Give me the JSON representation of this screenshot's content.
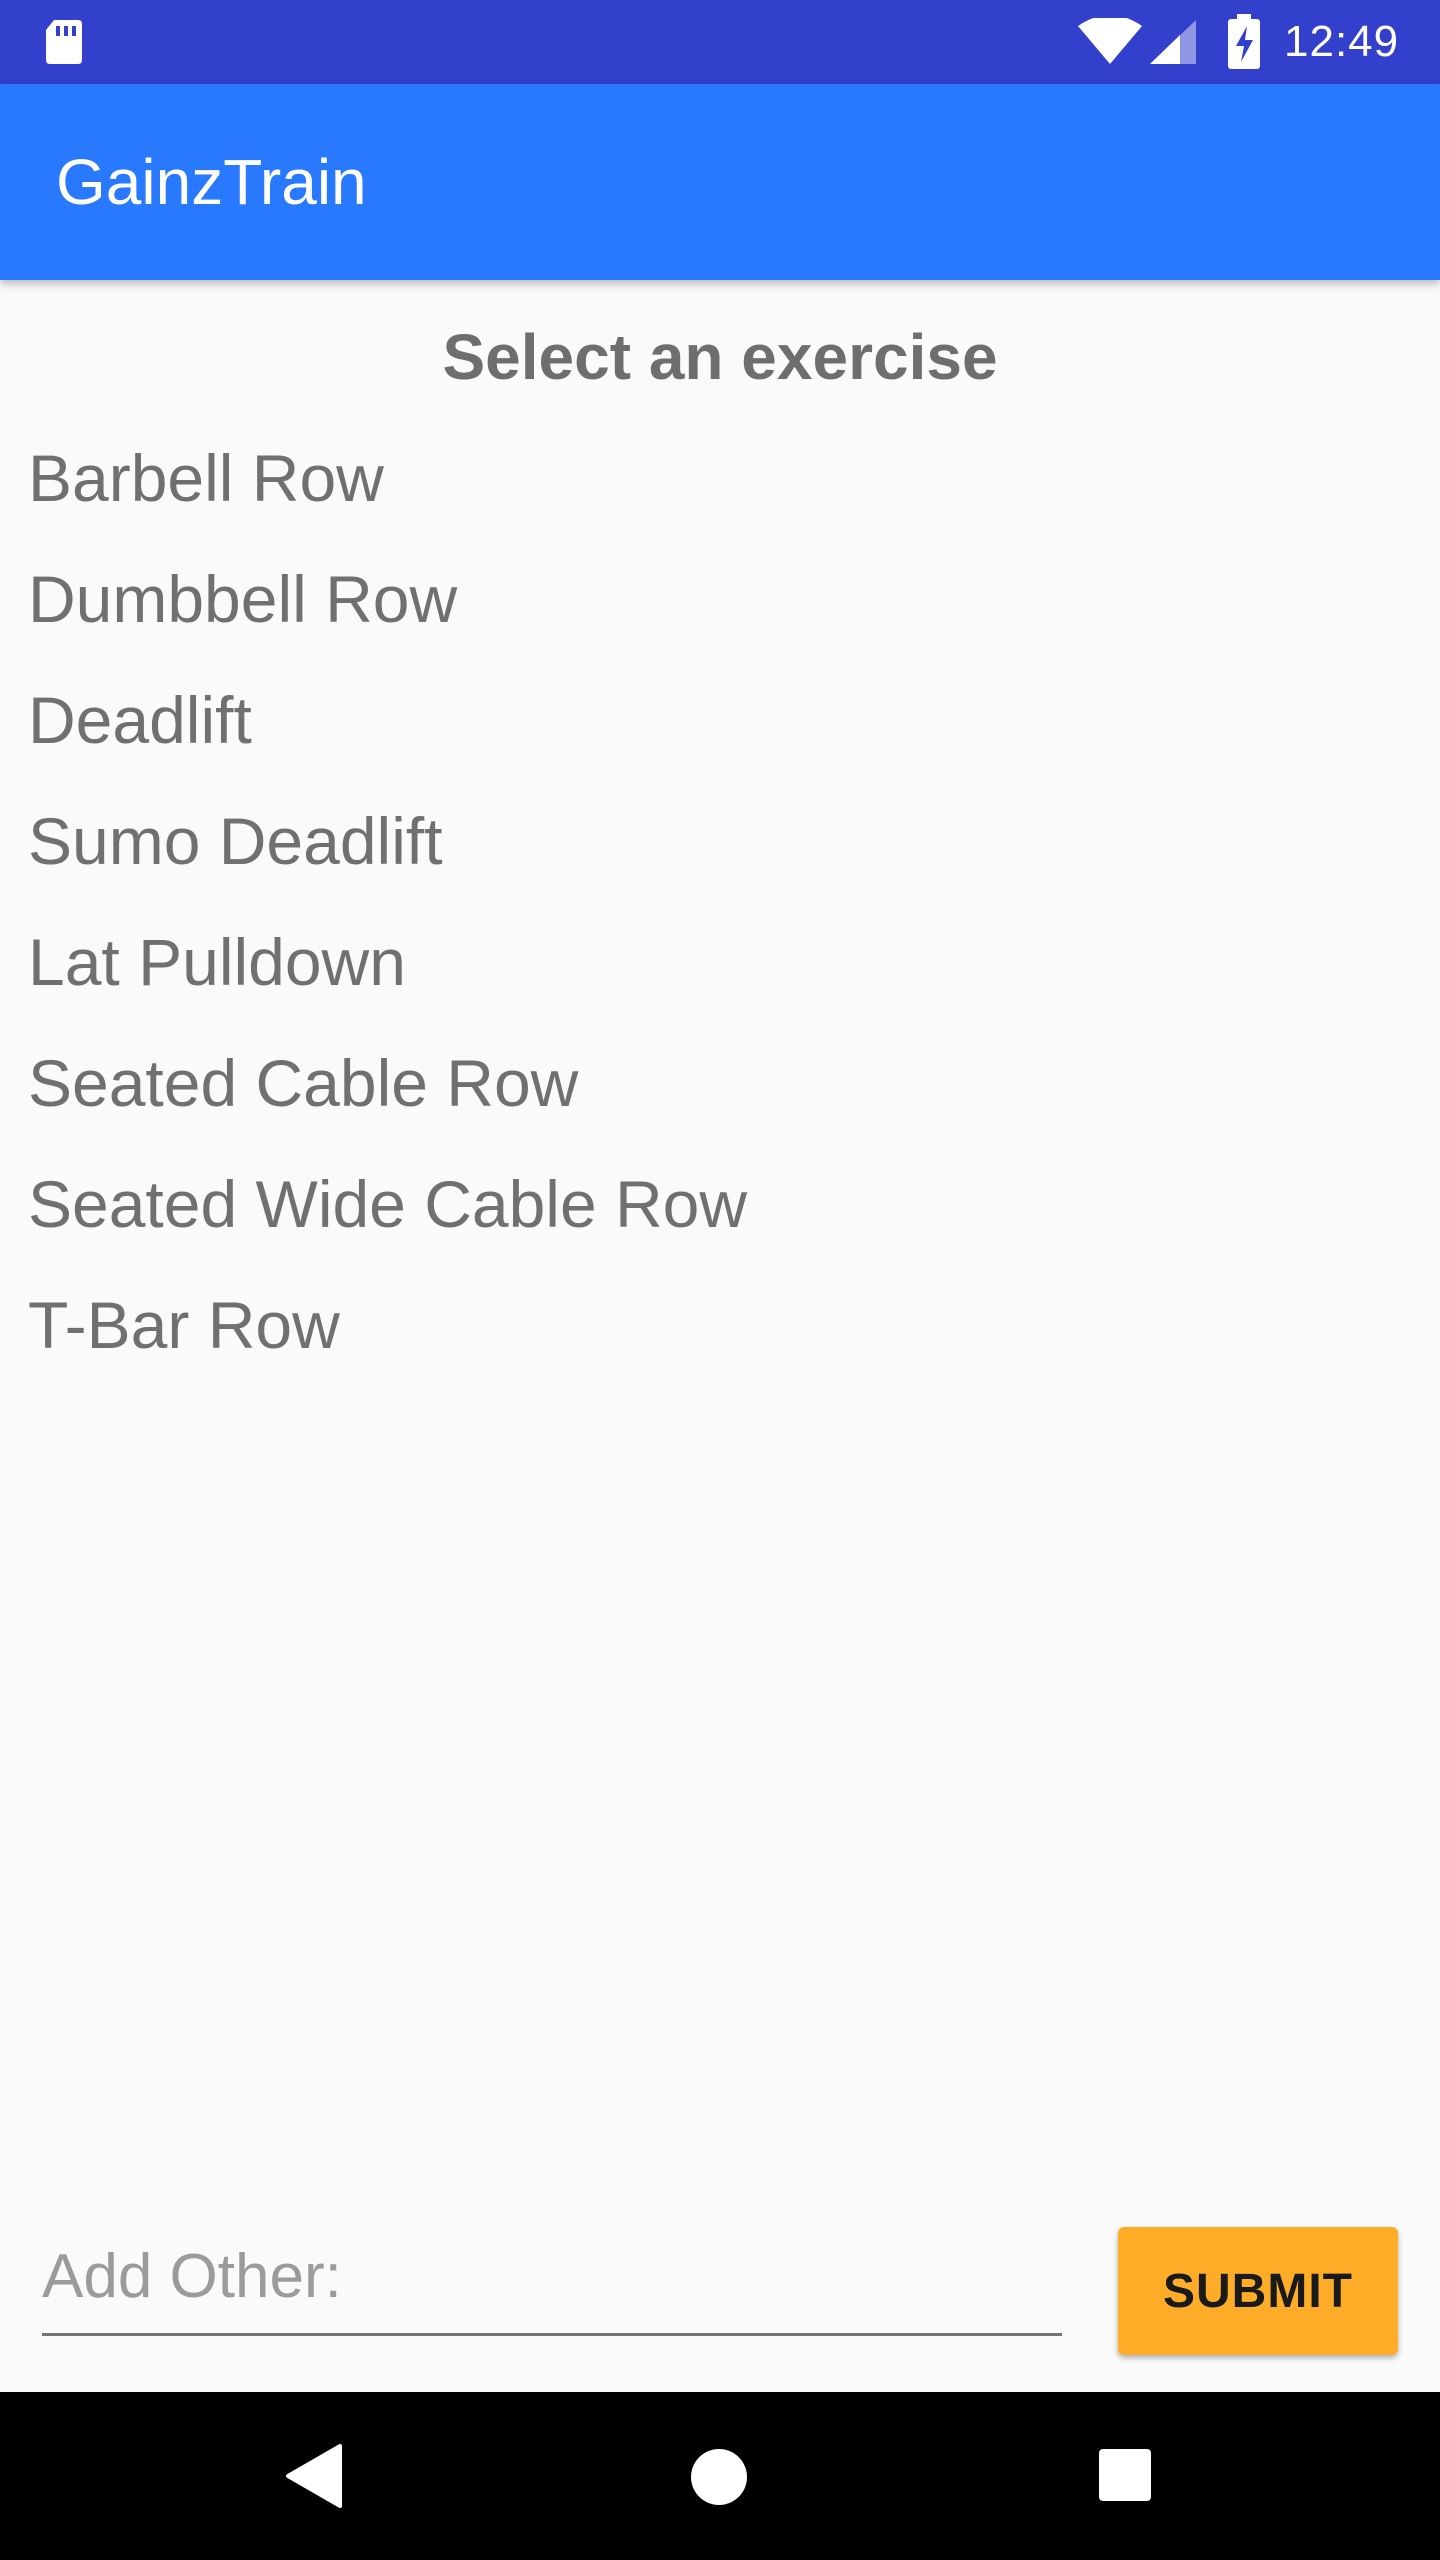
{
  "status_bar": {
    "time": "12:49",
    "icons": [
      "sd-card-icon",
      "wifi-icon",
      "signal-icon",
      "battery-charging-icon"
    ]
  },
  "app_bar": {
    "title": "GainzTrain"
  },
  "main": {
    "heading": "Select an exercise",
    "exercises": [
      "Barbell Row",
      "Dumbbell Row",
      "Deadlift",
      "Sumo Deadlift",
      "Lat Pulldown",
      "Seated Cable Row",
      "Seated Wide Cable Row",
      "T-Bar Row"
    ]
  },
  "add_other": {
    "value": "",
    "placeholder": "Add Other:",
    "submit_label": "SUBMIT"
  },
  "nav_bar": {
    "icons": [
      "back-icon",
      "home-icon",
      "recents-icon"
    ]
  },
  "colors": {
    "status_bar": "#3340cc",
    "app_bar": "#2979ff",
    "background": "#fafafa",
    "text": "#707070",
    "submit_button": "#ffad29",
    "nav_bar": "#000000"
  }
}
